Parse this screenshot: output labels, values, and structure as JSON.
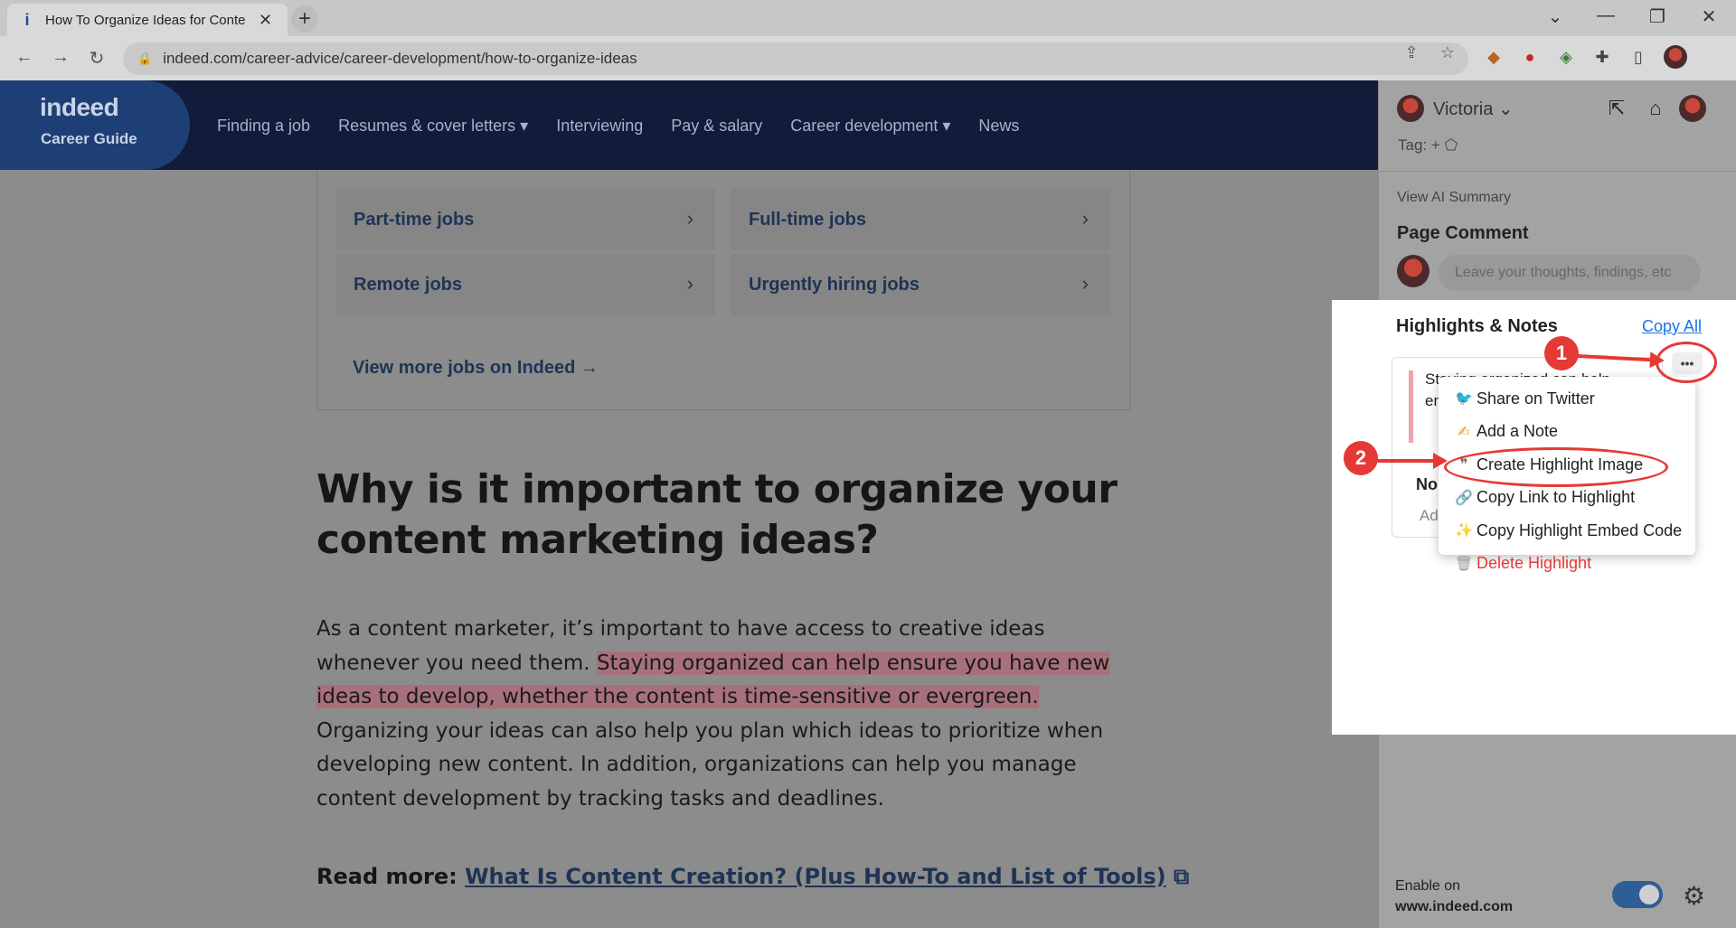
{
  "browser": {
    "tab_title": "How To Organize Ideas for Conte",
    "tab_favicon": "i",
    "url": "indeed.com/career-advice/career-development/how-to-organize-ideas"
  },
  "site": {
    "brand": "indeed",
    "sub": "Career Guide",
    "menu": [
      "Finding a job",
      "Resumes & cover letters ▾",
      "Interviewing",
      "Pay & salary",
      "Career development ▾",
      "News"
    ]
  },
  "jobs": {
    "tiles": [
      "Part-time jobs",
      "Full-time jobs",
      "Remote jobs",
      "Urgently hiring jobs"
    ],
    "view_more": "View more jobs on Indeed →"
  },
  "article": {
    "heading": "Why is it important to organize your content marketing ideas?",
    "p_before": "As a content marketer, it’s important to have access to creative ideas whenever you need them. ",
    "p_highlight": "Staying organized can help ensure you have new ideas to develop, whether the content is time-sensitive or evergreen.",
    "p_after": " Organizing your ideas can also help you plan which ideas to prioritize when developing new content. In addition, organizations can help you manage content development by tracking tasks and deadlines.",
    "read_more_label": "Read more: ",
    "read_more_link": "What Is Content Creation? (Plus How-To and List of Tools)"
  },
  "panel": {
    "user": "Victoria ⌄",
    "tag_label": "Tag:",
    "tag_add": "+",
    "view_ai": "View AI Summary",
    "page_comment": "Page Comment",
    "comment_placeholder": "Leave your thoughts, findings, etc",
    "highlights_title": "Highlights & Notes",
    "copy_all": "Copy All",
    "card_text": "Staying organized can help ensure yo w se",
    "card_notes": "No",
    "card_add": "Ad",
    "enable_line1": "Enable on",
    "enable_line2": "www.indeed.com"
  },
  "context_menu": [
    {
      "label": "Share on Twitter",
      "icon": "twitter-icon",
      "glyph": "🐦"
    },
    {
      "label": "Add a Note",
      "icon": "note-icon",
      "glyph": "✍"
    },
    {
      "label": "Create Highlight Image",
      "icon": "quote-icon",
      "glyph": "❞"
    },
    {
      "label": "Copy Link to Highlight",
      "icon": "link-icon",
      "glyph": "🔗"
    },
    {
      "label": "Copy Highlight Embed Code",
      "icon": "wand-icon",
      "glyph": "✨"
    },
    {
      "label": "Delete Highlight",
      "icon": "trash-icon",
      "glyph": "🗑"
    }
  ],
  "annotations": {
    "one": "1",
    "two": "2",
    "color": "#e53935"
  },
  "colors": {
    "site_header": "#101c3a",
    "highlight": "#f0a3b0",
    "link": "#1a73e8",
    "toggle": "#2d5e96"
  }
}
